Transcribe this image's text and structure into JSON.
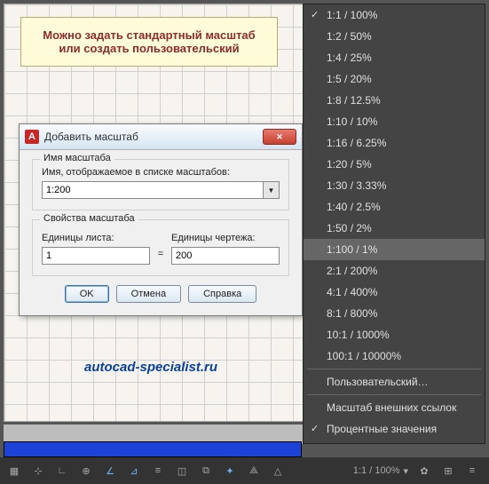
{
  "callout": {
    "text": "Можно задать стандартный масштаб или создать пользовательский"
  },
  "dialog": {
    "title": "Добавить масштаб",
    "name_group": "Имя масштаба",
    "name_label": "Имя, отображаемое в списке масштабов:",
    "name_value": "1:200",
    "props_group": "Свойства масштаба",
    "paper_label": "Единицы листа:",
    "paper_value": "1",
    "unit_eq": "=",
    "drawing_label": "Единицы чертежа:",
    "drawing_value": "200",
    "ok": "OK",
    "cancel": "Отмена",
    "help": "Справка"
  },
  "menu": {
    "items": [
      {
        "label": "1:1 / 100%",
        "checked": true
      },
      {
        "label": "1:2 / 50%"
      },
      {
        "label": "1:4 / 25%"
      },
      {
        "label": "1:5 / 20%"
      },
      {
        "label": "1:8 / 12.5%"
      },
      {
        "label": "1:10 / 10%"
      },
      {
        "label": "1:16 / 6.25%"
      },
      {
        "label": "1:20 / 5%"
      },
      {
        "label": "1:30 / 3.33%"
      },
      {
        "label": "1:40 / 2.5%"
      },
      {
        "label": "1:50 / 2%"
      },
      {
        "label": "1:100 / 1%",
        "highlight": true
      },
      {
        "label": "2:1 / 200%"
      },
      {
        "label": "4:1 / 400%"
      },
      {
        "label": "8:1 / 800%"
      },
      {
        "label": "10:1 / 1000%"
      },
      {
        "label": "100:1 / 10000%"
      },
      {
        "sep": true
      },
      {
        "label": "Пользовательский…"
      },
      {
        "sep": true
      },
      {
        "label": "Масштаб внешних ссылок"
      },
      {
        "label": "Процентные значения",
        "checked": true
      }
    ]
  },
  "credit": {
    "text": "autocad-specialist.ru"
  },
  "statusbar": {
    "scale_label": "1:1 / 100%"
  }
}
